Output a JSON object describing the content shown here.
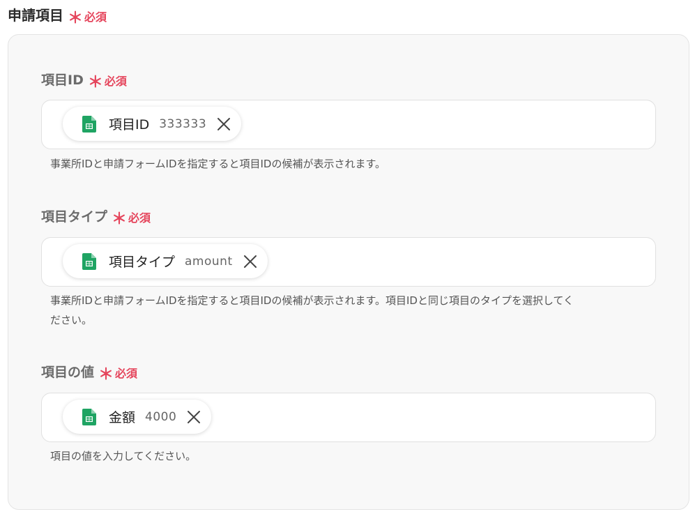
{
  "section": {
    "title": "申請項目",
    "required_star": "＊",
    "required_label": "必須"
  },
  "fields": [
    {
      "label": "項目ID",
      "required_star": "＊",
      "required_label": "必須",
      "chip": {
        "name": "項目ID",
        "value": "333333",
        "icon": "google-sheets-icon"
      },
      "help": "事業所IDと申請フォームIDを指定すると項目IDの候補が表示されます。"
    },
    {
      "label": "項目タイプ",
      "required_star": "＊",
      "required_label": "必須",
      "chip": {
        "name": "項目タイプ",
        "value": "amount",
        "icon": "google-sheets-icon"
      },
      "help_line1": "事業所IDと申請フォームIDを指定すると項目IDの候補が表示されます。項目IDと同じ項目のタイプを選択してく",
      "help_line2": "ださい。"
    },
    {
      "label": "項目の値",
      "required_star": "＊",
      "required_label": "必須",
      "chip": {
        "name": "金額",
        "value": "4000",
        "icon": "google-sheets-icon"
      },
      "help": "項目の値を入力してください。"
    }
  ],
  "colors": {
    "required": "#e5455c",
    "sheets_green": "#1fa463",
    "panel_bg": "#f8f8f8"
  }
}
